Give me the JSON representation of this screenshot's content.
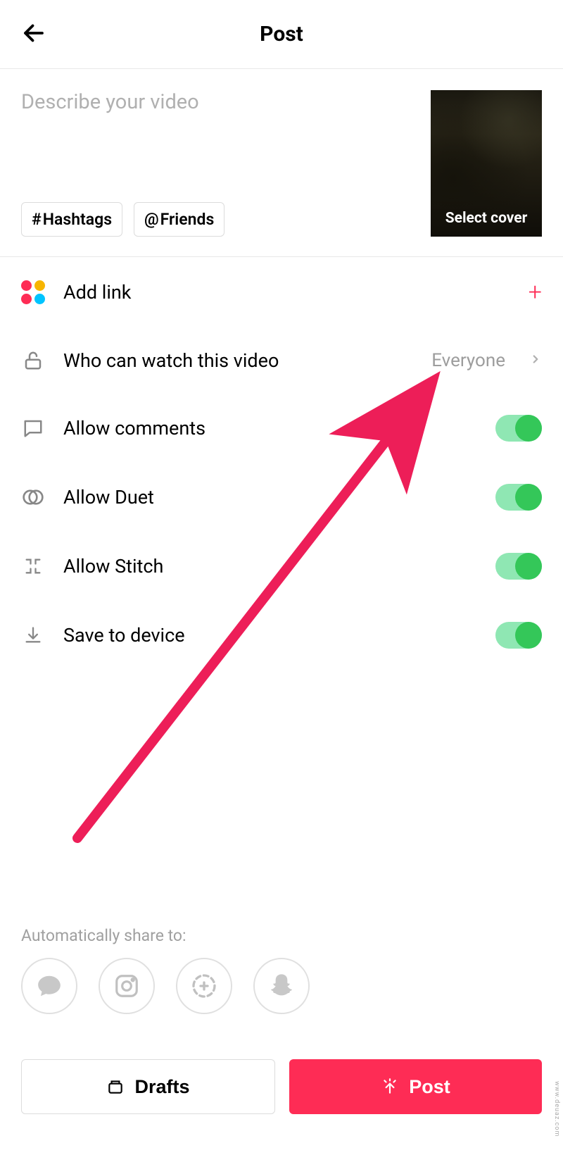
{
  "header": {
    "title": "Post"
  },
  "compose": {
    "caption_placeholder": "Describe your video",
    "hashtags_label": "Hashtags",
    "friends_label": "Friends",
    "cover_label": "Select cover"
  },
  "settings": {
    "add_link": {
      "label": "Add link"
    },
    "privacy": {
      "label": "Who can watch this video",
      "value": "Everyone"
    },
    "comments": {
      "label": "Allow comments",
      "on": true
    },
    "duet": {
      "label": "Allow Duet",
      "on": true
    },
    "stitch": {
      "label": "Allow Stitch",
      "on": true
    },
    "save": {
      "label": "Save to device",
      "on": true
    }
  },
  "share": {
    "label": "Automatically share to:"
  },
  "buttons": {
    "drafts": "Drafts",
    "post": "Post"
  },
  "watermark": "www.deuaz.com"
}
